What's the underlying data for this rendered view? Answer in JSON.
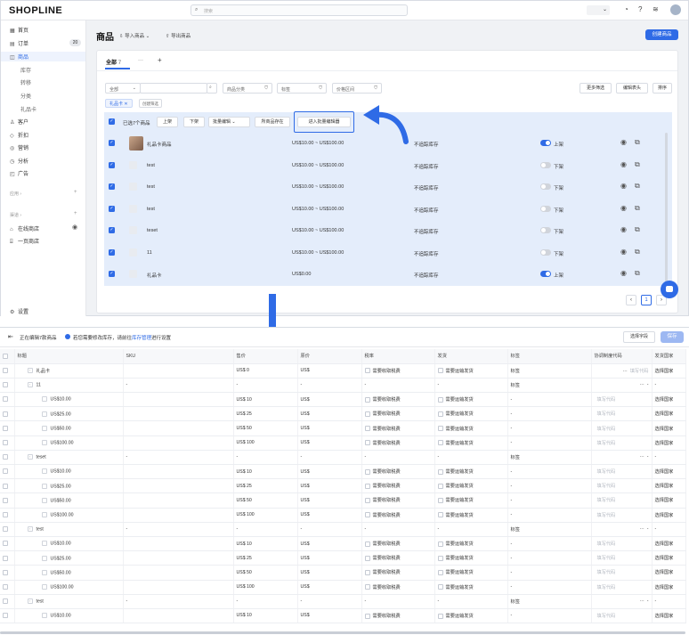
{
  "topbar": {
    "logo": "SHOPLINE",
    "search_placeholder": "搜索"
  },
  "sidebar": {
    "items": [
      {
        "label": "首页",
        "icon": "home-icon"
      },
      {
        "label": "订单",
        "icon": "order-icon",
        "badge": "20"
      },
      {
        "label": "商品",
        "icon": "product-icon",
        "active": true
      },
      {
        "label": "库存"
      },
      {
        "label": "转移"
      },
      {
        "label": "分类"
      },
      {
        "label": "礼品卡"
      },
      {
        "label": "客户",
        "icon": "customer-icon"
      },
      {
        "label": "折扣",
        "icon": "discount-icon"
      },
      {
        "label": "营销",
        "icon": "marketing-icon"
      },
      {
        "label": "分析",
        "icon": "analytics-icon"
      },
      {
        "label": "广告",
        "icon": "ads-icon"
      }
    ],
    "apps_label": "应用",
    "channels_label": "渠道",
    "channels": [
      {
        "label": "在线商店"
      },
      {
        "label": "一页商店"
      }
    ],
    "settings_label": "设置"
  },
  "main": {
    "title": "商品",
    "import_label": "导入商品",
    "export_label": "导出商品",
    "create_label": "创建商品",
    "tab_all": "全部",
    "tab_all_count": "7",
    "tab_more": "···",
    "tab_add": "+",
    "filters": {
      "all": "全部",
      "category": "商品分类",
      "tag": "标签",
      "price": "价格区间",
      "more": "更多筛选",
      "edit_header": "编辑表头",
      "sort": "排序"
    },
    "chip": "礼品卡",
    "chip_save": "创建筛选",
    "bulk": {
      "selected": "已选7个商品",
      "on_shelf": "上架",
      "off_shelf": "下架",
      "bulk_edit": "批量编辑",
      "move_to_collection": "所商品存在",
      "enter_bulk_editor": "进入批量编辑器"
    },
    "products": [
      {
        "name": "礼品卡商品",
        "price": "US$10.00 ~ US$100.00",
        "stock": "不追踪库存",
        "status": "上架",
        "on": true
      },
      {
        "name": "test",
        "price": "US$10.00 ~ US$100.00",
        "stock": "不追踪库存",
        "status": "下架",
        "on": false
      },
      {
        "name": "test",
        "price": "US$10.00 ~ US$100.00",
        "stock": "不追踪库存",
        "status": "下架",
        "on": false
      },
      {
        "name": "test",
        "price": "US$10.00 ~ US$100.00",
        "stock": "不追踪库存",
        "status": "下架",
        "on": false
      },
      {
        "name": "teset",
        "price": "US$10.00 ~ US$100.00",
        "stock": "不追踪库存",
        "status": "下架",
        "on": false
      },
      {
        "name": "11",
        "price": "US$10.00 ~ US$100.00",
        "stock": "不追踪库存",
        "status": "下架",
        "on": false
      },
      {
        "name": "礼品卡",
        "price": "US$0.00",
        "stock": "不追踪库存",
        "status": "上架",
        "on": true
      }
    ],
    "page": "1"
  },
  "editor": {
    "title": "正在编辑7款商品",
    "info_prefix": "若您需要修改库存，请前往",
    "info_link": "库存管理",
    "info_suffix": "进行设置",
    "select_fields": "选择字段",
    "save": "保存",
    "columns": [
      "标题",
      "SKU",
      "售价",
      "原价",
      "税率",
      "发货",
      "标签",
      "协调制度代码",
      "发货国家"
    ],
    "placeholders": {
      "tax": "需要收取税费",
      "ship": "需要运输发货",
      "tag": "标签",
      "hs": "填写代码",
      "country": "选择国家"
    },
    "rows": [
      {
        "level": 0,
        "title": "礼品卡",
        "sku": "",
        "price": "US$  0",
        "orig": "US$",
        "tag": "标签",
        "hs": "填写代码",
        "country": "选择国家",
        "has_checks": true
      },
      {
        "level": 0,
        "title": "11",
        "sku": "-",
        "price": "-",
        "orig": "-",
        "tag": "标签",
        "hs": "-",
        "country": "-",
        "has_checks": false,
        "dots": true
      },
      {
        "level": 1,
        "title": "US$10.00",
        "sku": "",
        "price": "US$  10",
        "orig": "US$",
        "tag": "-",
        "hs": "填写代码",
        "country": "选择国家",
        "has_checks": true
      },
      {
        "level": 1,
        "title": "US$25.00",
        "sku": "",
        "price": "US$  25",
        "orig": "US$",
        "tag": "-",
        "hs": "填写代码",
        "country": "选择国家",
        "has_checks": true
      },
      {
        "level": 1,
        "title": "US$50.00",
        "sku": "",
        "price": "US$  50",
        "orig": "US$",
        "tag": "-",
        "hs": "填写代码",
        "country": "选择国家",
        "has_checks": true
      },
      {
        "level": 1,
        "title": "US$100.00",
        "sku": "",
        "price": "US$  100",
        "orig": "US$",
        "tag": "-",
        "hs": "填写代码",
        "country": "选择国家",
        "has_checks": true
      },
      {
        "level": 0,
        "title": "teset",
        "sku": "-",
        "price": "-",
        "orig": "-",
        "tag": "标签",
        "hs": "-",
        "country": "-",
        "has_checks": false,
        "dots": true
      },
      {
        "level": 1,
        "title": "US$10.00",
        "sku": "",
        "price": "US$  10",
        "orig": "US$",
        "tag": "-",
        "hs": "填写代码",
        "country": "选择国家",
        "has_checks": true
      },
      {
        "level": 1,
        "title": "US$25.00",
        "sku": "",
        "price": "US$  25",
        "orig": "US$",
        "tag": "-",
        "hs": "填写代码",
        "country": "选择国家",
        "has_checks": true
      },
      {
        "level": 1,
        "title": "US$50.00",
        "sku": "",
        "price": "US$  50",
        "orig": "US$",
        "tag": "-",
        "hs": "填写代码",
        "country": "选择国家",
        "has_checks": true
      },
      {
        "level": 1,
        "title": "US$100.00",
        "sku": "",
        "price": "US$  100",
        "orig": "US$",
        "tag": "-",
        "hs": "填写代码",
        "country": "选择国家",
        "has_checks": true
      },
      {
        "level": 0,
        "title": "test",
        "sku": "-",
        "price": "-",
        "orig": "-",
        "tag": "标签",
        "hs": "-",
        "country": "-",
        "has_checks": false,
        "dots": true
      },
      {
        "level": 1,
        "title": "US$10.00",
        "sku": "",
        "price": "US$  10",
        "orig": "US$",
        "tag": "-",
        "hs": "填写代码",
        "country": "选择国家",
        "has_checks": true
      },
      {
        "level": 1,
        "title": "US$25.00",
        "sku": "",
        "price": "US$  25",
        "orig": "US$",
        "tag": "-",
        "hs": "填写代码",
        "country": "选择国家",
        "has_checks": true
      },
      {
        "level": 1,
        "title": "US$50.00",
        "sku": "",
        "price": "US$  50",
        "orig": "US$",
        "tag": "-",
        "hs": "填写代码",
        "country": "选择国家",
        "has_checks": true
      },
      {
        "level": 1,
        "title": "US$100.00",
        "sku": "",
        "price": "US$  100",
        "orig": "US$",
        "tag": "-",
        "hs": "填写代码",
        "country": "选择国家",
        "has_checks": true
      },
      {
        "level": 0,
        "title": "test",
        "sku": "-",
        "price": "-",
        "orig": "-",
        "tag": "标签",
        "hs": "-",
        "country": "-",
        "has_checks": false,
        "dots": true
      },
      {
        "level": 1,
        "title": "US$10.00",
        "sku": "",
        "price": "US$  10",
        "orig": "US$",
        "tag": "-",
        "hs": "填写代码",
        "country": "选择国家",
        "has_checks": true
      }
    ]
  },
  "colors": {
    "primary": "#2f6be6",
    "highlight_bg": "#e4edfb"
  }
}
